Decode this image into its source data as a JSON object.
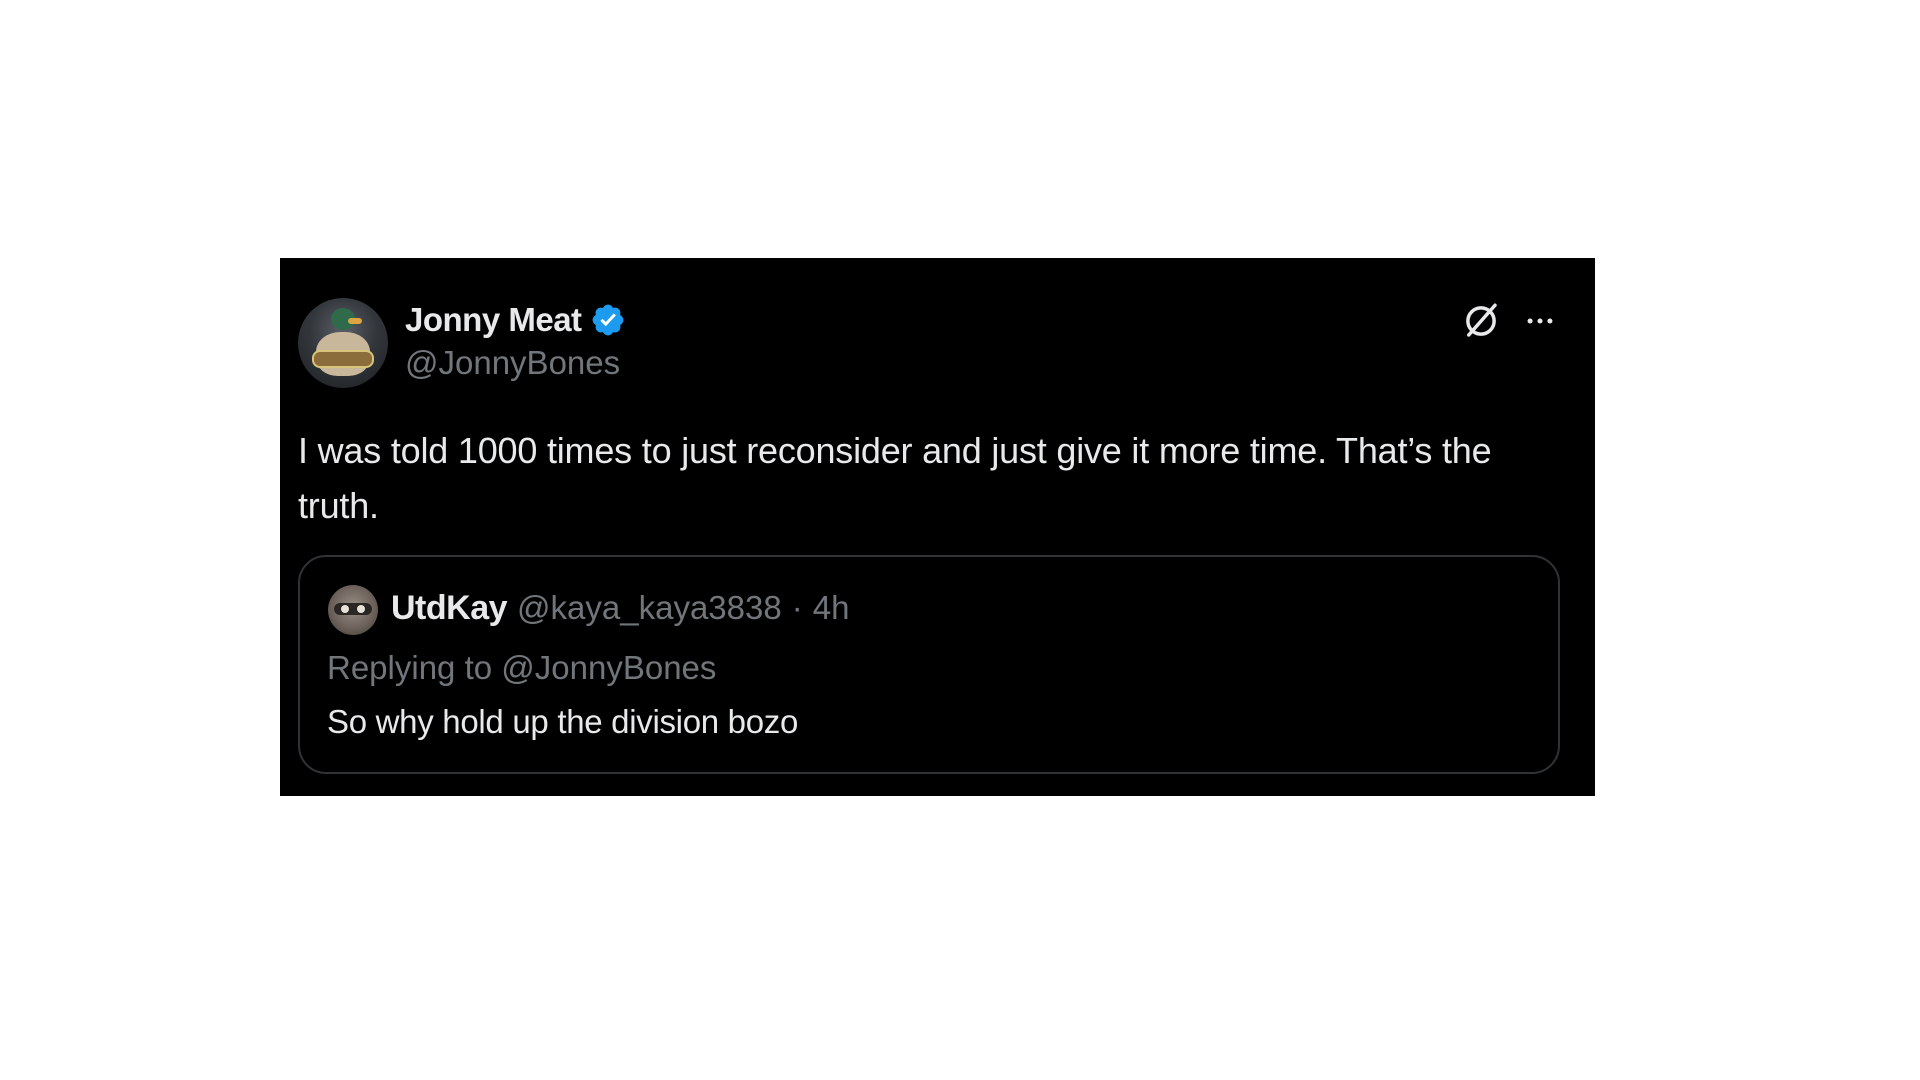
{
  "tweet": {
    "author": {
      "display_name": "Jonny Meat",
      "handle": "@JonnyBones",
      "verified": true,
      "avatar_icon": "duck-avatar"
    },
    "text": "I was told 1000 times to just reconsider and just give it more time. That’s the truth.",
    "actions": {
      "grok_icon": "grok-icon",
      "more_icon": "more-icon"
    }
  },
  "quote": {
    "author": {
      "display_name": "UtdKay",
      "handle": "@kaya_kaya3838",
      "avatar_icon": "user-avatar"
    },
    "separator": "·",
    "time": "4h",
    "replying_to": "Replying to @JonnyBones",
    "text": "So why hold up the division bozo"
  },
  "colors": {
    "background": "#000000",
    "text_primary": "#e7e9ea",
    "text_secondary": "#71767b",
    "verified_blue": "#1d9bf0",
    "border": "#2f3336"
  }
}
